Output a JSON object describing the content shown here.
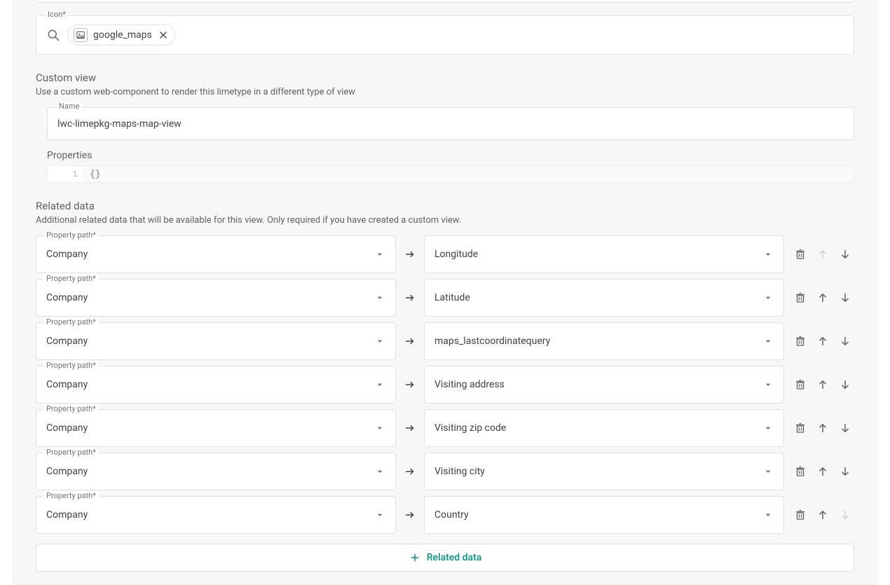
{
  "icon_field": {
    "label": "Icon*",
    "chip_value": "google_maps"
  },
  "custom_view": {
    "title": "Custom view",
    "subtitle": "Use a custom web-component to render this limetype in a different type of view",
    "name_label": "Name",
    "name_value": "lwc-limepkg-maps-map-view",
    "properties_label": "Properties",
    "code_line_no": "1",
    "code_text": "{}"
  },
  "related": {
    "title": "Related data",
    "subtitle": "Additional related data that will be available for this view. Only required if you have created a custom view.",
    "property_path_label": "Property path*",
    "rows": [
      {
        "left": "Company",
        "right": "Longitude",
        "up_disabled": true,
        "down_disabled": false
      },
      {
        "left": "Company",
        "right": "Latitude",
        "up_disabled": false,
        "down_disabled": false
      },
      {
        "left": "Company",
        "right": "maps_lastcoordinatequery",
        "up_disabled": false,
        "down_disabled": false
      },
      {
        "left": "Company",
        "right": "Visiting address",
        "up_disabled": false,
        "down_disabled": false
      },
      {
        "left": "Company",
        "right": "Visiting zip code",
        "up_disabled": false,
        "down_disabled": false
      },
      {
        "left": "Company",
        "right": "Visiting city",
        "up_disabled": false,
        "down_disabled": false
      },
      {
        "left": "Company",
        "right": "Country",
        "up_disabled": false,
        "down_disabled": true
      }
    ],
    "add_label": "Related data"
  }
}
